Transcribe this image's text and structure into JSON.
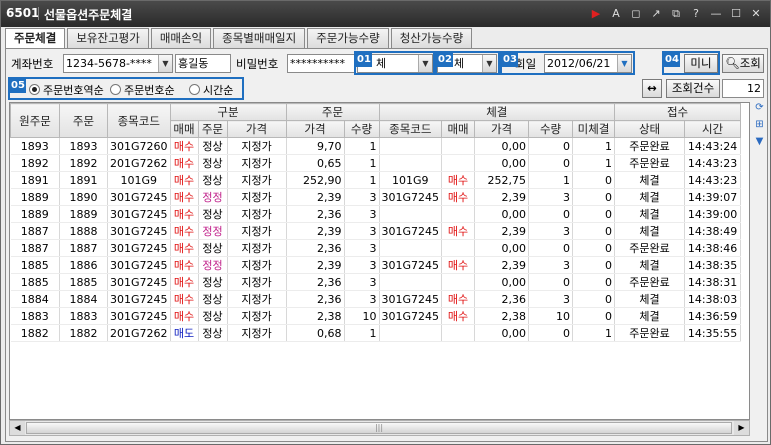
{
  "window": {
    "code": "6501",
    "title": "선물옵션주문체결"
  },
  "toolbar_icons": [
    "flag-icon",
    "text-size-icon",
    "window-icon",
    "pin-icon",
    "restore-icon",
    "help-icon",
    "minimize-icon",
    "maximize-icon",
    "close-icon"
  ],
  "toolbar_glyphs": {
    "flag": "▶",
    "text": "A",
    "win": "◻",
    "pin": "↗",
    "restore": "⧉",
    "help": "?",
    "min": "—",
    "max": "☐",
    "close": "✕"
  },
  "tabs": [
    "주문체결",
    "보유잔고평가",
    "매매손익",
    "종목별매매일지",
    "주문가능수량",
    "청산가능수량"
  ],
  "form": {
    "account_label": "계좌번호",
    "account_value": "1234-5678-****",
    "account_name": "홍길동",
    "password_label": "비밀번호",
    "password_value": "**********",
    "select1_value": "체",
    "select2_value": "체",
    "date_label": "회일",
    "date_value": "2012/06/21",
    "mini_button": "미니",
    "query_button": "조회",
    "badges": [
      "01",
      "02",
      "03",
      "04",
      "05"
    ]
  },
  "sort_options": {
    "options": [
      "주문번호역순",
      "주문번호순",
      "시간순"
    ],
    "selected": 0
  },
  "count": {
    "label": "조회건수",
    "value": "12",
    "arrow": "↔"
  },
  "table": {
    "group_headers": [
      "구분",
      "주문",
      "체결",
      "접수"
    ],
    "columns": [
      "원주문",
      "주문",
      "종목코드",
      "매매",
      "주문",
      "가격",
      "가격",
      "수량",
      "종목코드",
      "매매",
      "가격",
      "수량",
      "미체결",
      "상태",
      "시간"
    ],
    "rows": [
      [
        "1893",
        "1893",
        "301G7260",
        "매수",
        "정상",
        "지정가",
        "9,70",
        "1",
        "",
        "",
        "0,00",
        "0",
        "1",
        "주문완료",
        "14:43:24"
      ],
      [
        "1892",
        "1892",
        "201G7262",
        "매수",
        "정상",
        "지정가",
        "0,65",
        "1",
        "",
        "",
        "0,00",
        "0",
        "1",
        "주문완료",
        "14:43:23"
      ],
      [
        "1891",
        "1891",
        "101G9",
        "매수",
        "정상",
        "지정가",
        "252,90",
        "1",
        "101G9",
        "매수",
        "252,75",
        "1",
        "0",
        "체결",
        "14:43:23"
      ],
      [
        "1889",
        "1890",
        "301G7245",
        "매수",
        "정정",
        "지정가",
        "2,39",
        "3",
        "301G7245",
        "매수",
        "2,39",
        "3",
        "0",
        "체결",
        "14:39:07"
      ],
      [
        "1889",
        "1889",
        "301G7245",
        "매수",
        "정상",
        "지정가",
        "2,36",
        "3",
        "",
        "",
        "0,00",
        "0",
        "0",
        "체결",
        "14:39:00"
      ],
      [
        "1887",
        "1888",
        "301G7245",
        "매수",
        "정정",
        "지정가",
        "2,39",
        "3",
        "301G7245",
        "매수",
        "2,39",
        "3",
        "0",
        "체결",
        "14:38:49"
      ],
      [
        "1887",
        "1887",
        "301G7245",
        "매수",
        "정상",
        "지정가",
        "2,36",
        "3",
        "",
        "",
        "0,00",
        "0",
        "0",
        "주문완료",
        "14:38:46"
      ],
      [
        "1885",
        "1886",
        "301G7245",
        "매수",
        "정정",
        "지정가",
        "2,39",
        "3",
        "301G7245",
        "매수",
        "2,39",
        "3",
        "0",
        "체결",
        "14:38:35"
      ],
      [
        "1885",
        "1885",
        "301G7245",
        "매수",
        "정상",
        "지정가",
        "2,36",
        "3",
        "",
        "",
        "0,00",
        "0",
        "0",
        "주문완료",
        "14:38:31"
      ],
      [
        "1884",
        "1884",
        "301G7245",
        "매수",
        "정상",
        "지정가",
        "2,36",
        "3",
        "301G7245",
        "매수",
        "2,36",
        "3",
        "0",
        "체결",
        "14:38:03"
      ],
      [
        "1883",
        "1883",
        "301G7245",
        "매수",
        "정상",
        "지정가",
        "2,38",
        "10",
        "301G7245",
        "매수",
        "2,38",
        "10",
        "0",
        "체결",
        "14:36:59"
      ],
      [
        "1882",
        "1882",
        "201G7262",
        "매도",
        "정상",
        "지정가",
        "0,68",
        "1",
        "",
        "",
        "0,00",
        "0",
        "1",
        "주문완료",
        "14:35:55"
      ]
    ]
  },
  "colors": {
    "buy": "#e01010",
    "sell": "#1020c0",
    "modify": "#c0208a",
    "accent": "#1f6fc0"
  }
}
